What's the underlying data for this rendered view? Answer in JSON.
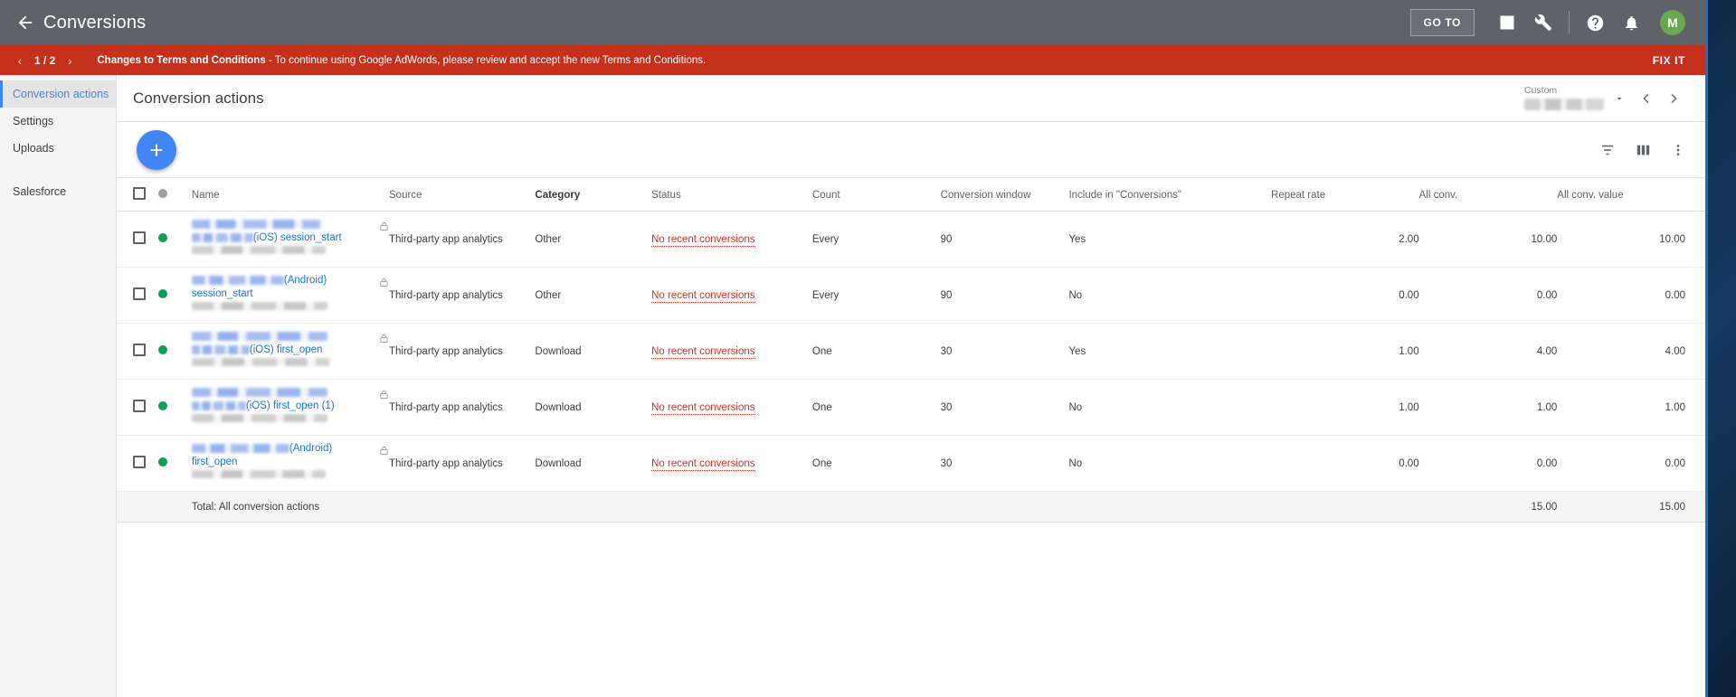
{
  "appbar": {
    "back_icon": "back-arrow-icon",
    "title": "Conversions",
    "goto_label": "GO TO",
    "icons": [
      "reports-bar-chart-icon",
      "tools-wrench-icon",
      "help-icon",
      "notifications-bell-icon"
    ],
    "avatar_initial": "M",
    "avatar_color": "#6aa84f",
    "background": "#5f6368"
  },
  "banner": {
    "prev": "‹",
    "counter": "1 / 2",
    "next": "›",
    "title": "Changes to Terms and Conditions",
    "separator": " - ",
    "message": "To continue using Google AdWords, please review and accept the new Terms and Conditions.",
    "action_label": "FIX IT",
    "background": "#c5301d"
  },
  "sidebar": {
    "items": [
      {
        "label": "Conversion actions",
        "active": true
      },
      {
        "label": "Settings",
        "active": false
      },
      {
        "label": "Uploads",
        "active": false
      },
      {
        "label": "Salesforce",
        "active": false
      }
    ]
  },
  "page": {
    "title": "Conversion actions"
  },
  "daterange": {
    "label": "Custom",
    "value": "",
    "caret_icon": "chevron-down-icon",
    "prev_icon": "chevron-left-icon",
    "next_icon": "chevron-right-icon"
  },
  "toolbar": {
    "add_label": "+",
    "filter_icon": "filter-icon",
    "columns_icon": "columns-icon",
    "more_icon": "more-vert-icon"
  },
  "table": {
    "headers": [
      {
        "label": "",
        "key": "check"
      },
      {
        "label": "",
        "key": "dot"
      },
      {
        "label": "Name",
        "key": "name",
        "sorted": false
      },
      {
        "label": "Source",
        "key": "source",
        "sorted": false
      },
      {
        "label": "Category",
        "key": "category",
        "sorted": true
      },
      {
        "label": "Status",
        "key": "status",
        "sorted": false
      },
      {
        "label": "Count",
        "key": "count",
        "sorted": false
      },
      {
        "label": "Conversion window",
        "key": "window",
        "sorted": false
      },
      {
        "label": "Include in \"Conversions\"",
        "key": "include",
        "sorted": false
      },
      {
        "label": "Repeat rate",
        "key": "repeat",
        "sorted": false
      },
      {
        "label": "All conv.",
        "key": "allconv",
        "sorted": false
      },
      {
        "label": "All conv. value",
        "key": "allconvvalue",
        "sorted": false
      }
    ],
    "rows": [
      {
        "status_dot": "green",
        "name_suffix": "(iOS) session_start",
        "name_layout": "two-blur-lines",
        "locked": true,
        "source": "Third-party app analytics",
        "category": "Other",
        "status": "No recent conversions",
        "count": "Every",
        "window": "90",
        "include": "Yes",
        "repeat_rate": "2.00",
        "all_conv": "10.00",
        "all_conv_value": "10.00"
      },
      {
        "status_dot": "green",
        "name_suffix": "(Android)",
        "name_second_line": "session_start",
        "name_layout": "one-blur-line",
        "locked": true,
        "source": "Third-party app analytics",
        "category": "Other",
        "status": "No recent conversions",
        "count": "Every",
        "window": "90",
        "include": "No",
        "repeat_rate": "0.00",
        "all_conv": "0.00",
        "all_conv_value": "0.00"
      },
      {
        "status_dot": "green",
        "name_suffix": "(iOS) first_open",
        "name_layout": "two-blur-lines",
        "locked": true,
        "source": "Third-party app analytics",
        "category": "Download",
        "status": "No recent conversions",
        "count": "One",
        "window": "30",
        "include": "Yes",
        "repeat_rate": "1.00",
        "all_conv": "4.00",
        "all_conv_value": "4.00"
      },
      {
        "status_dot": "green",
        "name_suffix": "(iOS) first_open (1)",
        "name_layout": "two-blur-lines",
        "locked": true,
        "source": "Third-party app analytics",
        "category": "Download",
        "status": "No recent conversions",
        "count": "One",
        "window": "30",
        "include": "No",
        "repeat_rate": "1.00",
        "all_conv": "1.00",
        "all_conv_value": "1.00"
      },
      {
        "status_dot": "green",
        "name_suffix": "(Android)",
        "name_second_line": "first_open",
        "name_layout": "one-blur-line",
        "locked": true,
        "source": "Third-party app analytics",
        "category": "Download",
        "status": "No recent conversions",
        "count": "One",
        "window": "30",
        "include": "No",
        "repeat_rate": "0.00",
        "all_conv": "0.00",
        "all_conv_value": "0.00"
      }
    ],
    "total": {
      "label": "Total: All conversion actions",
      "all_conv": "15.00",
      "all_conv_value": "15.00"
    }
  },
  "colors": {
    "accent_blue": "#4285f4",
    "link_blue": "#1a73e8",
    "status_red": "#d93025",
    "banner_red": "#c5301d",
    "appbar_gray": "#5f6368",
    "green_dot": "#0f9d58"
  }
}
